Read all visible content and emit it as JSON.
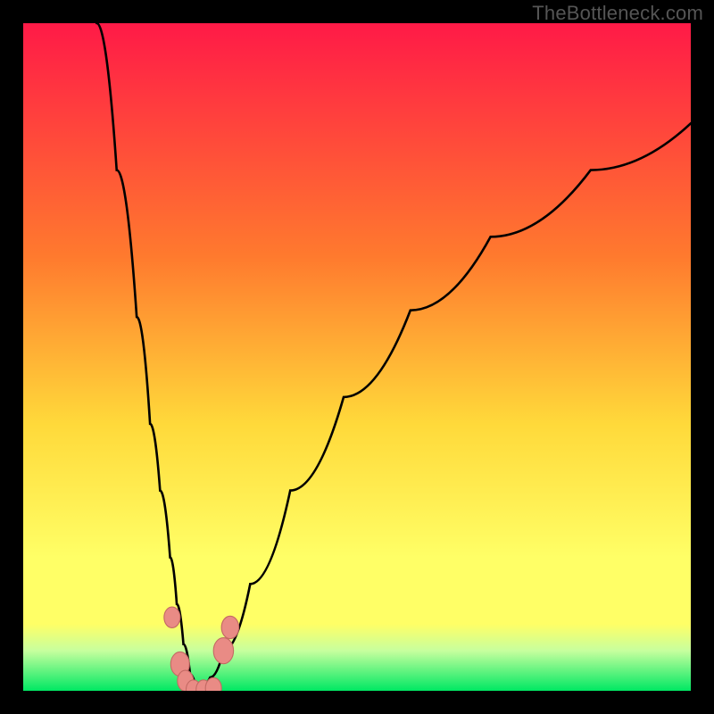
{
  "watermark": "TheBottleneck.com",
  "colors": {
    "black": "#000000",
    "curve": "#000000",
    "marker_fill": "#e98b85",
    "marker_stroke": "#c46a64",
    "grad_top": "#ff1a47",
    "grad_mid1": "#ff7a2e",
    "grad_mid2": "#ffd93a",
    "grad_yellow": "#ffff66",
    "grad_green_pale": "#c7ff9e",
    "grad_green": "#00e863"
  },
  "chart_data": {
    "type": "line",
    "title": "",
    "xlabel": "",
    "ylabel": "",
    "xlim": [
      0,
      100
    ],
    "ylim": [
      0,
      100
    ],
    "description": "Bottleneck curve: y represents bottleneck percentage (top=100%, bottom=0%) across an x parameter. Two branches form a V with minimum near x≈26.",
    "series": [
      {
        "name": "left-branch",
        "x": [
          11.0,
          14.0,
          17.0,
          19.0,
          20.5,
          22.0,
          23.0,
          24.0,
          25.0,
          26.0
        ],
        "y": [
          100.0,
          78.0,
          56.0,
          40.0,
          30.0,
          20.0,
          13.0,
          7.0,
          2.5,
          0.0
        ]
      },
      {
        "name": "right-branch",
        "x": [
          26.0,
          28.0,
          30.0,
          34.0,
          40.0,
          48.0,
          58.0,
          70.0,
          85.0,
          100.0
        ],
        "y": [
          0.0,
          2.0,
          6.0,
          16.0,
          30.0,
          44.0,
          57.0,
          68.0,
          78.0,
          85.0
        ]
      }
    ],
    "markers": [
      {
        "x": 22.3,
        "y": 11.0,
        "r": 1.2
      },
      {
        "x": 23.5,
        "y": 4.0,
        "r": 1.4
      },
      {
        "x": 24.3,
        "y": 1.5,
        "r": 1.2
      },
      {
        "x": 25.5,
        "y": 0.2,
        "r": 1.1
      },
      {
        "x": 27.0,
        "y": 0.2,
        "r": 1.1
      },
      {
        "x": 28.5,
        "y": 0.4,
        "r": 1.2
      },
      {
        "x": 30.0,
        "y": 6.0,
        "r": 1.5
      },
      {
        "x": 31.0,
        "y": 9.5,
        "r": 1.3
      }
    ],
    "gradient_stops_pct": [
      0,
      35,
      60,
      80,
      90,
      94,
      100
    ]
  }
}
